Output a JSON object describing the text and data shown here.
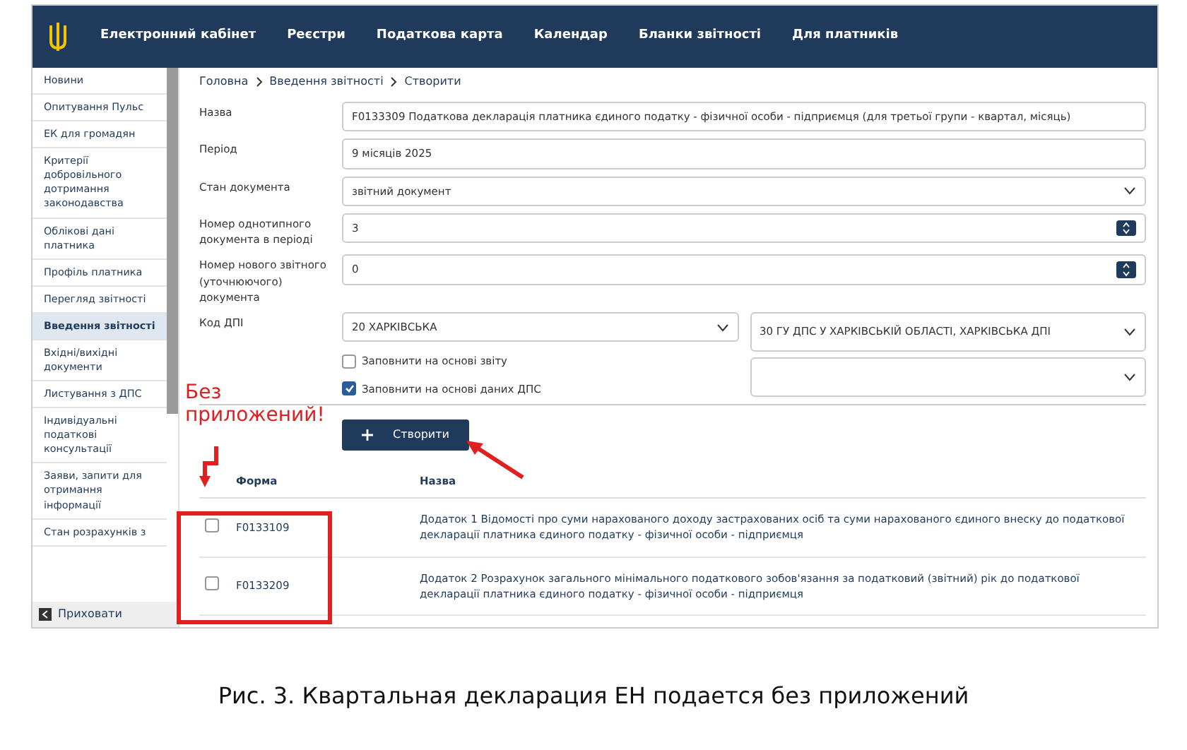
{
  "navbar": {
    "items": [
      {
        "label": "Електронний кабінет"
      },
      {
        "label": "Реєстри"
      },
      {
        "label": "Податкова карта"
      },
      {
        "label": "Календар"
      },
      {
        "label": "Бланки звітності"
      },
      {
        "label": "Для платників"
      }
    ]
  },
  "sidebar": {
    "items": [
      {
        "label": "Новини",
        "selected": false
      },
      {
        "label": "Опитування Пульс",
        "selected": false
      },
      {
        "label": "ЕК для громадян",
        "selected": false
      },
      {
        "label": "Критерії добровільного дотримання законодавства",
        "selected": false
      },
      {
        "label": "Облікові дані платника",
        "selected": false
      },
      {
        "label": "Профіль платника",
        "selected": false
      },
      {
        "label": "Перегляд звітності",
        "selected": false
      },
      {
        "label": "Введення звітності",
        "selected": true
      },
      {
        "label": "Вхідні/вихідні документи",
        "selected": false
      },
      {
        "label": "Листування з ДПС",
        "selected": false
      },
      {
        "label": "Індивідуальні податкові консультації",
        "selected": false
      },
      {
        "label": "Заяви, запити для отримання інформації",
        "selected": false
      },
      {
        "label": "Стан розрахунків з",
        "selected": false
      }
    ],
    "hide_label": "Приховати"
  },
  "breadcrumb": [
    "Головна",
    "Введення звітності",
    "Створити"
  ],
  "form": {
    "fields": [
      {
        "kind": "text",
        "label": "Назва",
        "value": "F0133309 Податкова декларація платника єдиного податку - фізичної особи - підприємця (для третьої групи - квартал, місяць)"
      },
      {
        "kind": "text",
        "label": "Період",
        "value": "9 місяців 2025"
      },
      {
        "kind": "select",
        "label": "Стан документа",
        "value": "звітний документ"
      },
      {
        "kind": "spin",
        "label": "Номер однотипного документа в періоді",
        "value": "3"
      },
      {
        "kind": "spin",
        "label": "Номер нового звітного (уточнюючого) документа",
        "value": "0"
      }
    ],
    "dps_label": "Код ДПІ",
    "dps_region": "20 ХАРКІВСЬКА",
    "dps_office": "30 ГУ ДПС У ХАРКІВСЬКІЙ ОБЛАСТІ, ХАРКІВСЬКА ДПІ",
    "checks": [
      {
        "label": "Заповнити на основі звіту",
        "checked": false
      },
      {
        "label": "Заповнити на основі даних ДПС",
        "checked": true
      }
    ],
    "create_button": "Створити"
  },
  "table": {
    "columns": [
      "Форма",
      "Назва"
    ],
    "rows": [
      {
        "checked": false,
        "form": "F0133109",
        "name": "Додаток 1 Відомості про суми нарахованого доходу застрахованих осіб та суми нарахованого єдиного внеску до податкової декларації платника єдиного податку - фізичної особи - підприємця"
      },
      {
        "checked": false,
        "form": "F0133209",
        "name": "Додаток 2 Розрахунок загального мінімального податкового зобов'язання за податковий (звітний) рік до податкової декларації платника єдиного податку - фізичної особи - підприємця"
      }
    ]
  },
  "annotation": {
    "text": "Без приложений!"
  },
  "caption": "Рис. 3. Квартальная декларация ЕН подается без приложений"
}
